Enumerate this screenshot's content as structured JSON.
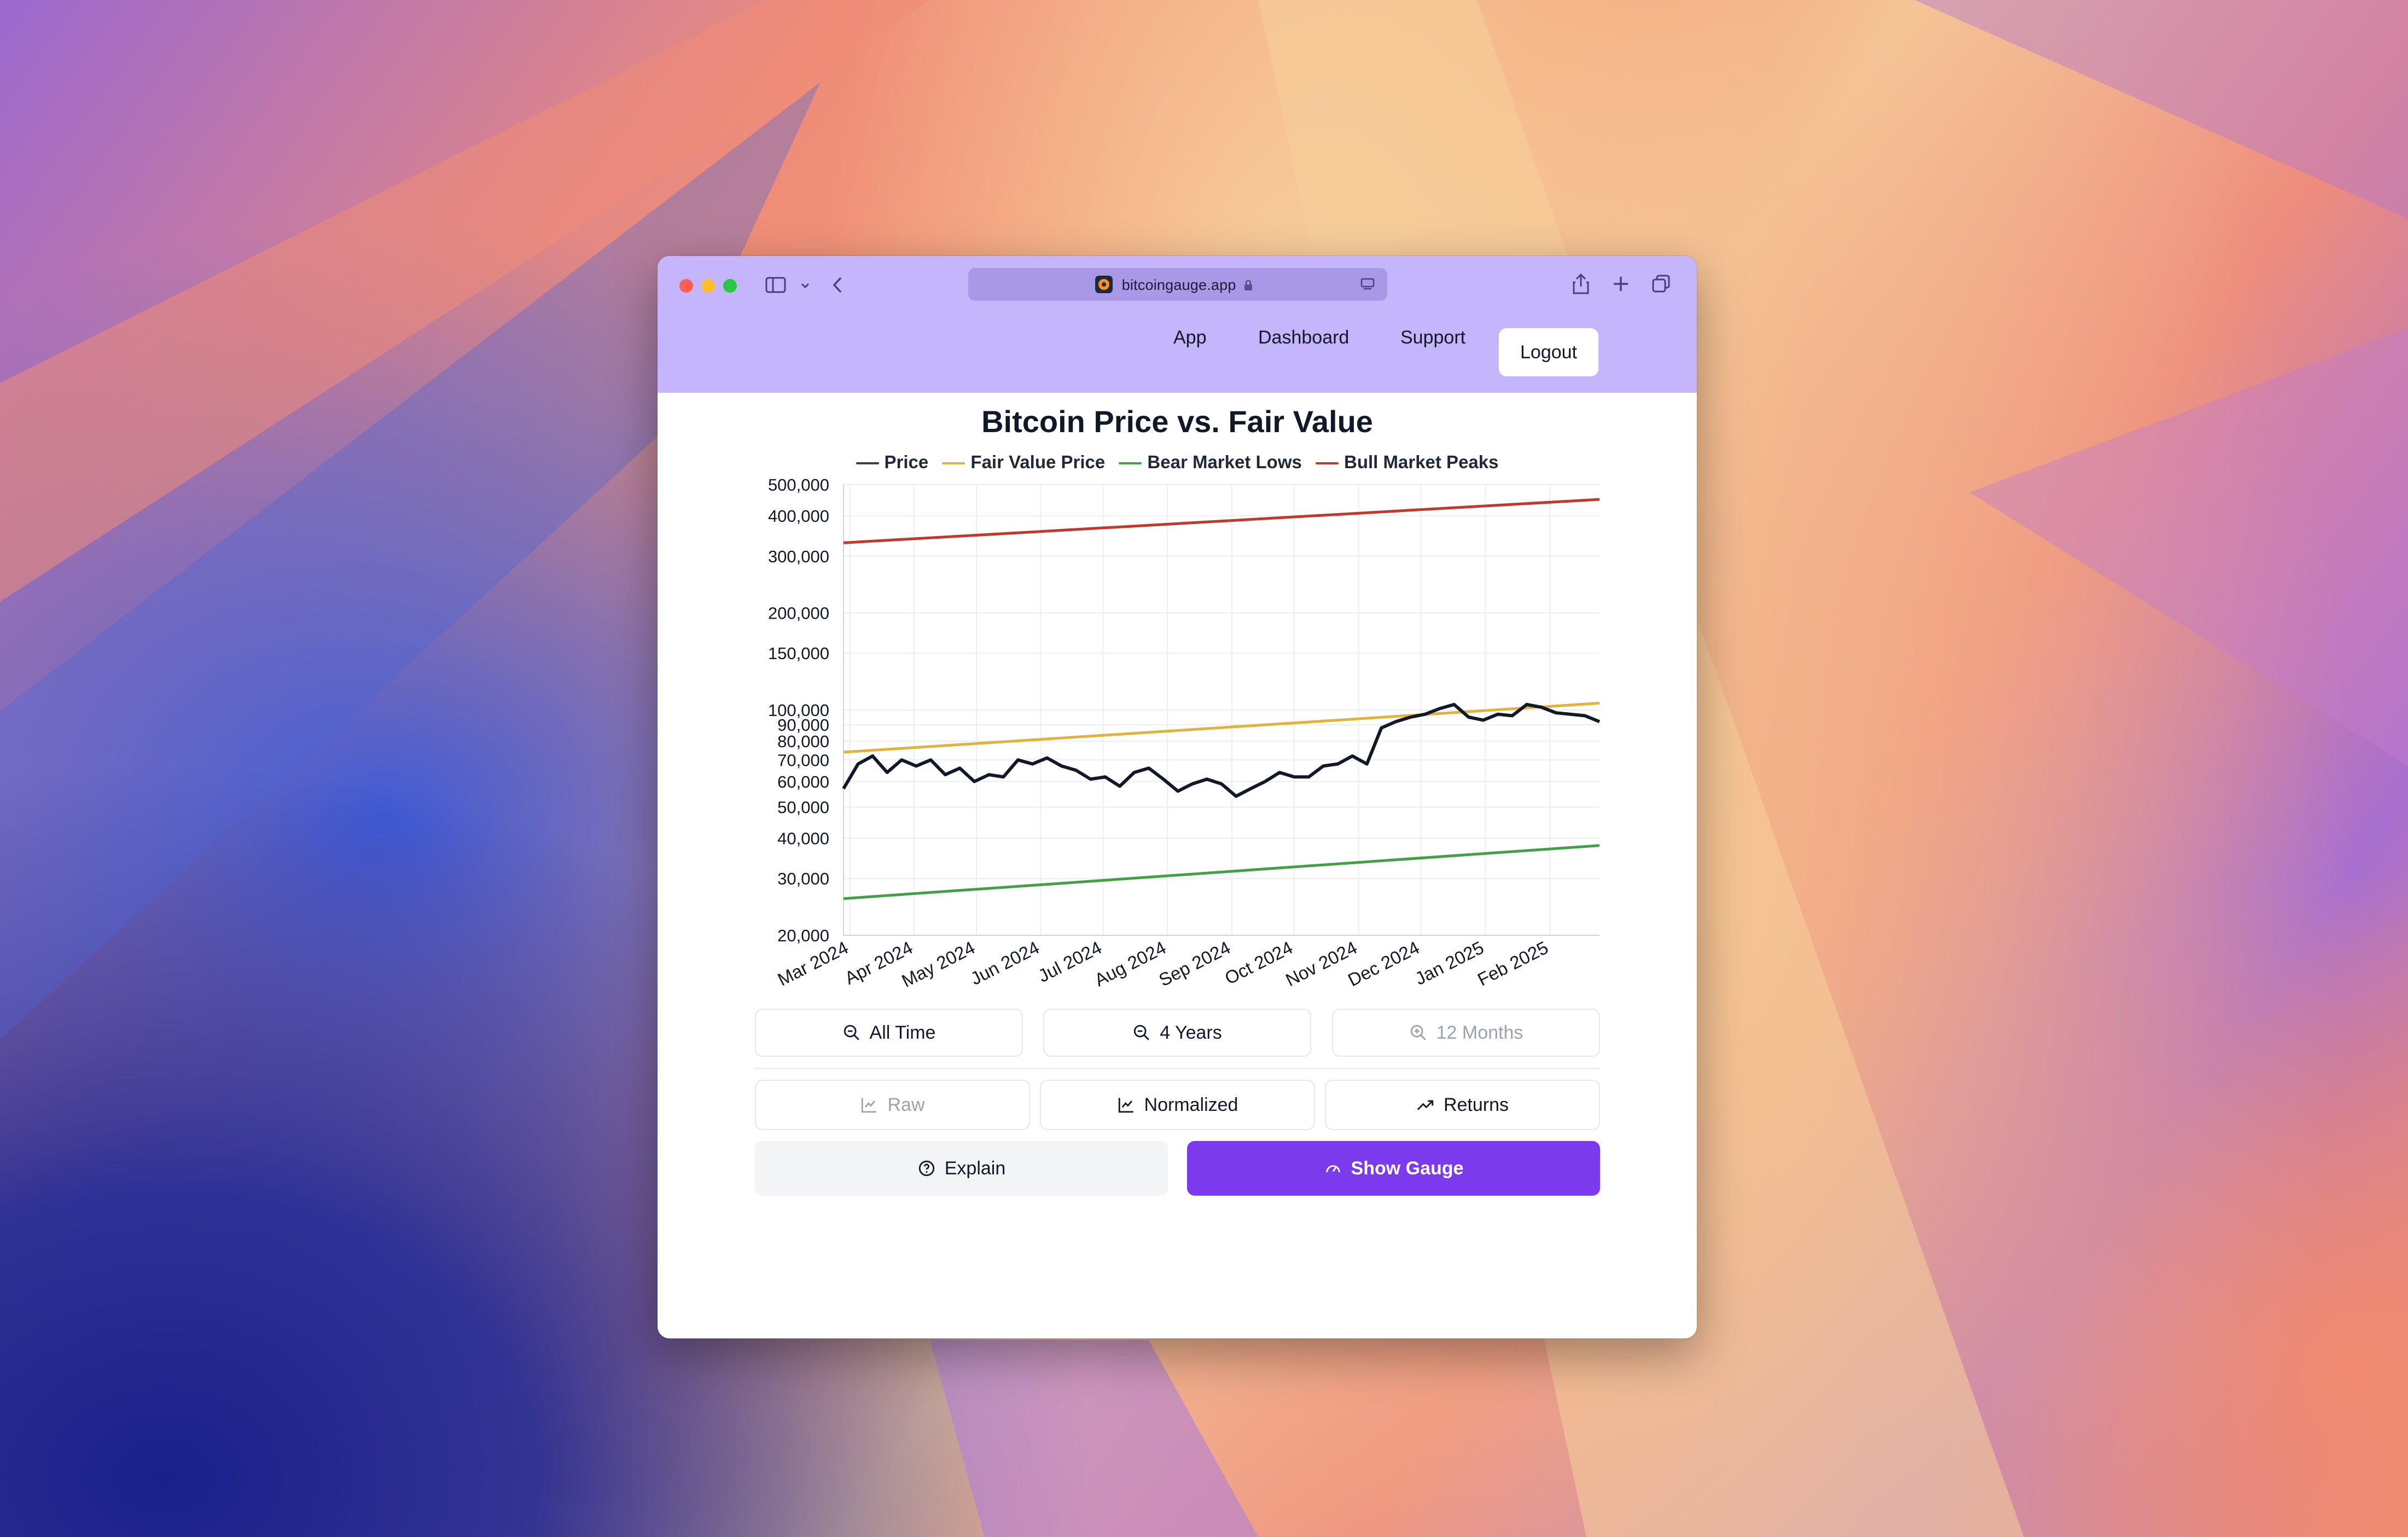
{
  "browser": {
    "url": "bitcoingauge.app"
  },
  "nav": {
    "app": "App",
    "dashboard": "Dashboard",
    "support": "Support",
    "logout": "Logout"
  },
  "chart_data": {
    "type": "line",
    "title": "Bitcoin Price vs. Fair Value",
    "y_scale": "log",
    "ylim": [
      20000,
      500000
    ],
    "y_ticks": [
      {
        "value": 500000,
        "label": "500,000"
      },
      {
        "value": 400000,
        "label": "400,000"
      },
      {
        "value": 300000,
        "label": "300,000"
      },
      {
        "value": 200000,
        "label": "200,000"
      },
      {
        "value": 150000,
        "label": "150,000"
      },
      {
        "value": 100000,
        "label": "100,000"
      },
      {
        "value": 90000,
        "label": "90,000"
      },
      {
        "value": 80000,
        "label": "80,000"
      },
      {
        "value": 70000,
        "label": "70,000"
      },
      {
        "value": 60000,
        "label": "60,000"
      },
      {
        "value": 50000,
        "label": "50,000"
      },
      {
        "value": 40000,
        "label": "40,000"
      },
      {
        "value": 30000,
        "label": "30,000"
      },
      {
        "value": 20000,
        "label": "20,000"
      }
    ],
    "x_ticks": [
      "Mar 2024",
      "Apr 2024",
      "May 2024",
      "Jun 2024",
      "Jul 2024",
      "Aug 2024",
      "Sep 2024",
      "Oct 2024",
      "Nov 2024",
      "Dec 2024",
      "Jan 2025",
      "Feb 2025"
    ],
    "x": [
      "2024-02-27",
      "2024-03-05",
      "2024-03-12",
      "2024-03-19",
      "2024-03-26",
      "2024-04-02",
      "2024-04-09",
      "2024-04-16",
      "2024-04-23",
      "2024-04-30",
      "2024-05-07",
      "2024-05-14",
      "2024-05-21",
      "2024-05-28",
      "2024-06-04",
      "2024-06-11",
      "2024-06-18",
      "2024-06-25",
      "2024-07-02",
      "2024-07-09",
      "2024-07-16",
      "2024-07-23",
      "2024-07-30",
      "2024-08-06",
      "2024-08-13",
      "2024-08-20",
      "2024-08-27",
      "2024-09-03",
      "2024-09-10",
      "2024-09-17",
      "2024-09-24",
      "2024-10-01",
      "2024-10-08",
      "2024-10-15",
      "2024-10-22",
      "2024-10-29",
      "2024-11-05",
      "2024-11-12",
      "2024-11-19",
      "2024-11-26",
      "2024-12-03",
      "2024-12-10",
      "2024-12-17",
      "2024-12-24",
      "2024-12-31",
      "2025-01-07",
      "2025-01-14",
      "2025-01-21",
      "2025-01-28",
      "2025-02-04",
      "2025-02-11",
      "2025-02-18",
      "2025-02-25"
    ],
    "series": [
      {
        "name": "Price",
        "color": "#111827",
        "values": [
          57000,
          68000,
          72000,
          64000,
          70000,
          67000,
          70000,
          63000,
          66000,
          60000,
          63000,
          62000,
          70000,
          68000,
          71000,
          67000,
          65000,
          61000,
          62000,
          58000,
          64000,
          66000,
          61000,
          56000,
          59000,
          61000,
          59000,
          54000,
          57000,
          60000,
          64000,
          62000,
          62000,
          67000,
          68000,
          72000,
          68000,
          88000,
          92000,
          95000,
          97000,
          101000,
          104000,
          95000,
          93000,
          97000,
          96000,
          104000,
          102000,
          98000,
          97000,
          96000,
          92000
        ]
      },
      {
        "name": "Fair Value Price",
        "color": "#e2b23f",
        "values": [
          74000,
          105000
        ]
      },
      {
        "name": "Bear Market Lows",
        "color": "#43a047",
        "values": [
          26000,
          38000
        ]
      },
      {
        "name": "Bull Market Peaks",
        "color": "#c0392b",
        "values": [
          330000,
          450000
        ]
      }
    ]
  },
  "range_buttons": {
    "all_time": "All Time",
    "four_years": "4 Years",
    "twelve_months": "12 Months"
  },
  "mode_buttons": {
    "raw": "Raw",
    "normalized": "Normalized",
    "returns": "Returns"
  },
  "action_buttons": {
    "explain": "Explain",
    "show_gauge": "Show Gauge"
  }
}
